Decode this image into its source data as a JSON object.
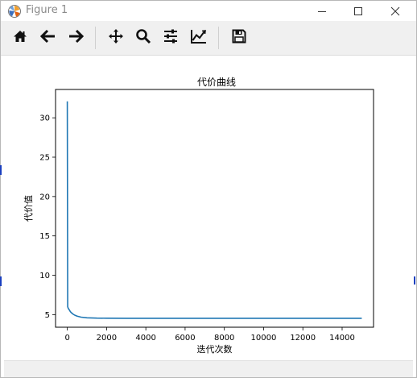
{
  "window": {
    "title": "Figure 1",
    "minimize_icon": "minimize-icon",
    "maximize_icon": "maximize-icon",
    "close_icon": "close-icon"
  },
  "toolbar": {
    "buttons": [
      {
        "name": "home-button",
        "icon": "home-icon"
      },
      {
        "name": "back-button",
        "icon": "arrow-left-icon"
      },
      {
        "name": "forward-button",
        "icon": "arrow-right-icon"
      },
      {
        "name": "pan-button",
        "icon": "move-icon"
      },
      {
        "name": "zoom-button",
        "icon": "magnifier-icon"
      },
      {
        "name": "subplots-button",
        "icon": "sliders-icon"
      },
      {
        "name": "edit-axis-button",
        "icon": "line-chart-icon"
      },
      {
        "name": "save-button",
        "icon": "floppy-disk-icon"
      }
    ]
  },
  "chart_data": {
    "type": "line",
    "title": "代价曲线",
    "xlabel": "迭代次数",
    "ylabel": "代价值",
    "xlim": [
      -600,
      15600
    ],
    "ylim": [
      3.4,
      33.6
    ],
    "xticks": [
      0,
      2000,
      4000,
      6000,
      8000,
      10000,
      12000,
      14000
    ],
    "yticks": [
      5,
      10,
      15,
      20,
      25,
      30
    ],
    "grid": false,
    "line_color": "#1f77b4",
    "series": [
      {
        "x": [
          0,
          20,
          50,
          100,
          150,
          200,
          300,
          400,
          500,
          700,
          1000,
          1500,
          2000,
          3000,
          5000,
          8000,
          12000,
          15000
        ],
        "y": [
          32.1,
          6.0,
          5.8,
          5.6,
          5.4,
          5.25,
          5.05,
          4.9,
          4.8,
          4.68,
          4.6,
          4.56,
          4.55,
          4.54,
          4.54,
          4.54,
          4.54,
          4.54
        ]
      }
    ]
  }
}
